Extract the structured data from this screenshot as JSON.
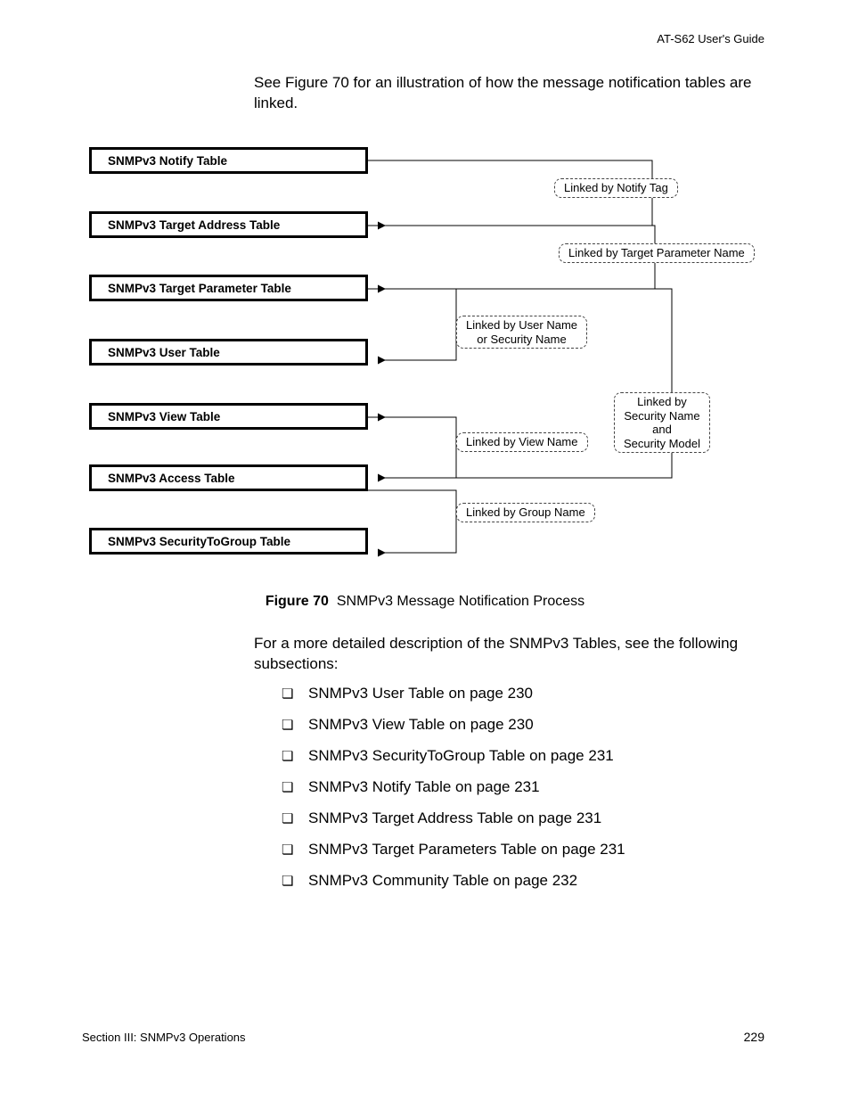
{
  "header": {
    "guide": "AT-S62 User's Guide"
  },
  "intro": "See Figure 70 for an illustration of how the message notification tables are linked.",
  "diagram": {
    "boxes": [
      "SNMPv3 Notify Table",
      "SNMPv3 Target Address Table",
      "SNMPv3 Target Parameter Table",
      "SNMPv3 User Table",
      "SNMPv3 View Table",
      "SNMPv3 Access Table",
      "SNMPv3 SecurityToGroup Table"
    ],
    "links": [
      "Linked by Notify Tag",
      "Linked by Target Parameter Name",
      "Linked by User Name\nor Security Name",
      "Linked by View Name",
      "Linked by\nSecurity Name\nand\nSecurity Model",
      "Linked by Group Name"
    ]
  },
  "caption": {
    "label": "Figure 70",
    "text": "SNMPv3 Message Notification Process"
  },
  "detail": "For a more detailed description of the SNMPv3 Tables, see the following subsections:",
  "bullets": [
    "SNMPv3 User Table on page 230",
    "SNMPv3 View Table on page 230",
    "SNMPv3 SecurityToGroup Table on page 231",
    "SNMPv3 Notify Table on page 231",
    "SNMPv3 Target Address Table on page 231",
    "SNMPv3 Target Parameters Table on page 231",
    "SNMPv3 Community Table on page 232"
  ],
  "footer": {
    "section": "Section III: SNMPv3 Operations",
    "page": "229"
  }
}
